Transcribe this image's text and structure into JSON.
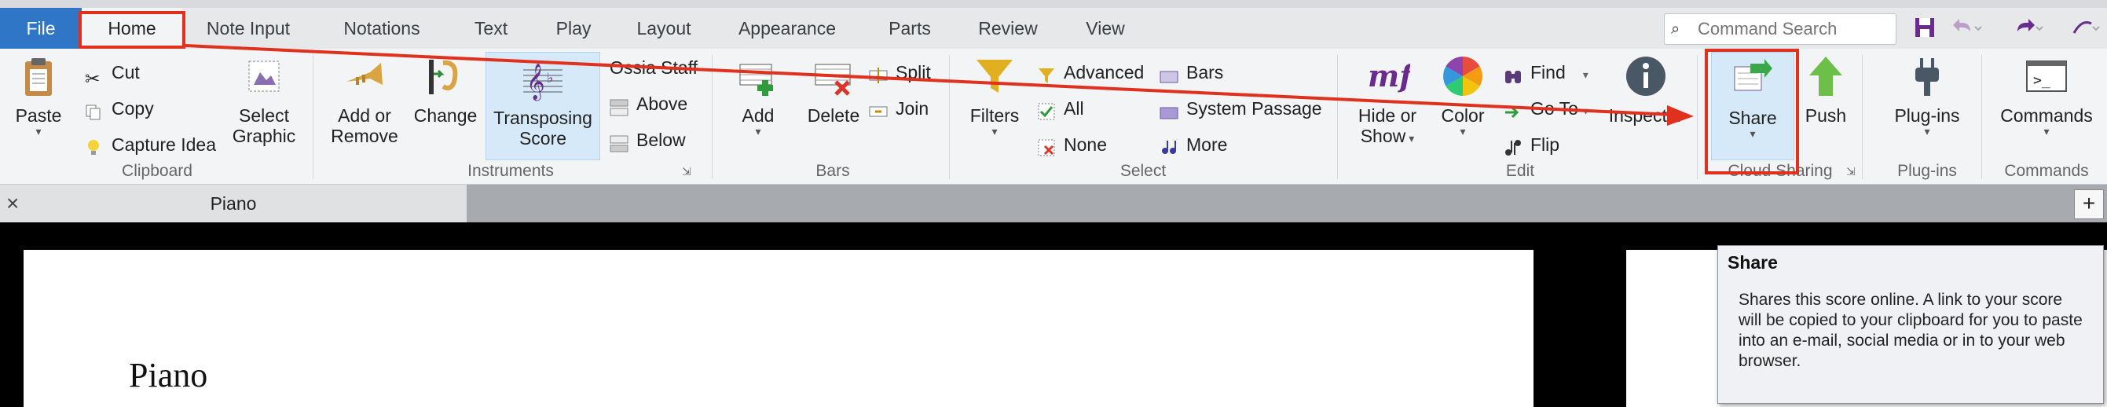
{
  "menu_tabs": [
    "File",
    "Home",
    "Note Input",
    "Notations",
    "Text",
    "Play",
    "Layout",
    "Appearance",
    "Parts",
    "Review",
    "View"
  ],
  "search": {
    "placeholder": "Command Search"
  },
  "groups": {
    "clipboard": {
      "label": "Clipboard",
      "paste": "Paste",
      "cut": "Cut",
      "copy": "Copy",
      "capture_idea": "Capture Idea",
      "select_graphic_1": "Select",
      "select_graphic_2": "Graphic"
    },
    "instruments": {
      "label": "Instruments",
      "add_or_remove_1": "Add or",
      "add_or_remove_2": "Remove",
      "change": "Change",
      "transposing_1": "Transposing",
      "transposing_2": "Score",
      "ossia_staff": "Ossia Staff",
      "above": "Above",
      "below": "Below"
    },
    "bars": {
      "label": "Bars",
      "add": "Add",
      "delete": "Delete",
      "split": "Split",
      "join": "Join"
    },
    "select": {
      "label": "Select",
      "filters": "Filters",
      "advanced": "Advanced",
      "all": "All",
      "none": "None",
      "bars": "Bars",
      "system_passage": "System Passage",
      "more": "More"
    },
    "edit": {
      "label": "Edit",
      "hide_or_show_1": "Hide or",
      "hide_or_show_2": "Show",
      "color": "Color",
      "find": "Find",
      "go_to": "Go To",
      "flip": "Flip",
      "inspector": "Inspector"
    },
    "cloud_sharing": {
      "label": "Cloud Sharing",
      "share": "Share",
      "push": "Push"
    },
    "plugins": {
      "label": "Plug-ins",
      "plugins": "Plug-ins"
    },
    "commands": {
      "label": "Commands",
      "commands": "Commands"
    }
  },
  "doc_tab": {
    "title": "Piano"
  },
  "score": {
    "title": "Piano"
  },
  "tooltip": {
    "title": "Share",
    "body": "Shares this score online. A link to your score will be copied to your clipboard for you to paste into an e-mail, social media or in to your web browser."
  },
  "colors": {
    "accent": "#2f77c6",
    "annotation": "#e0301e",
    "ribbon": "#f3f4f5"
  }
}
